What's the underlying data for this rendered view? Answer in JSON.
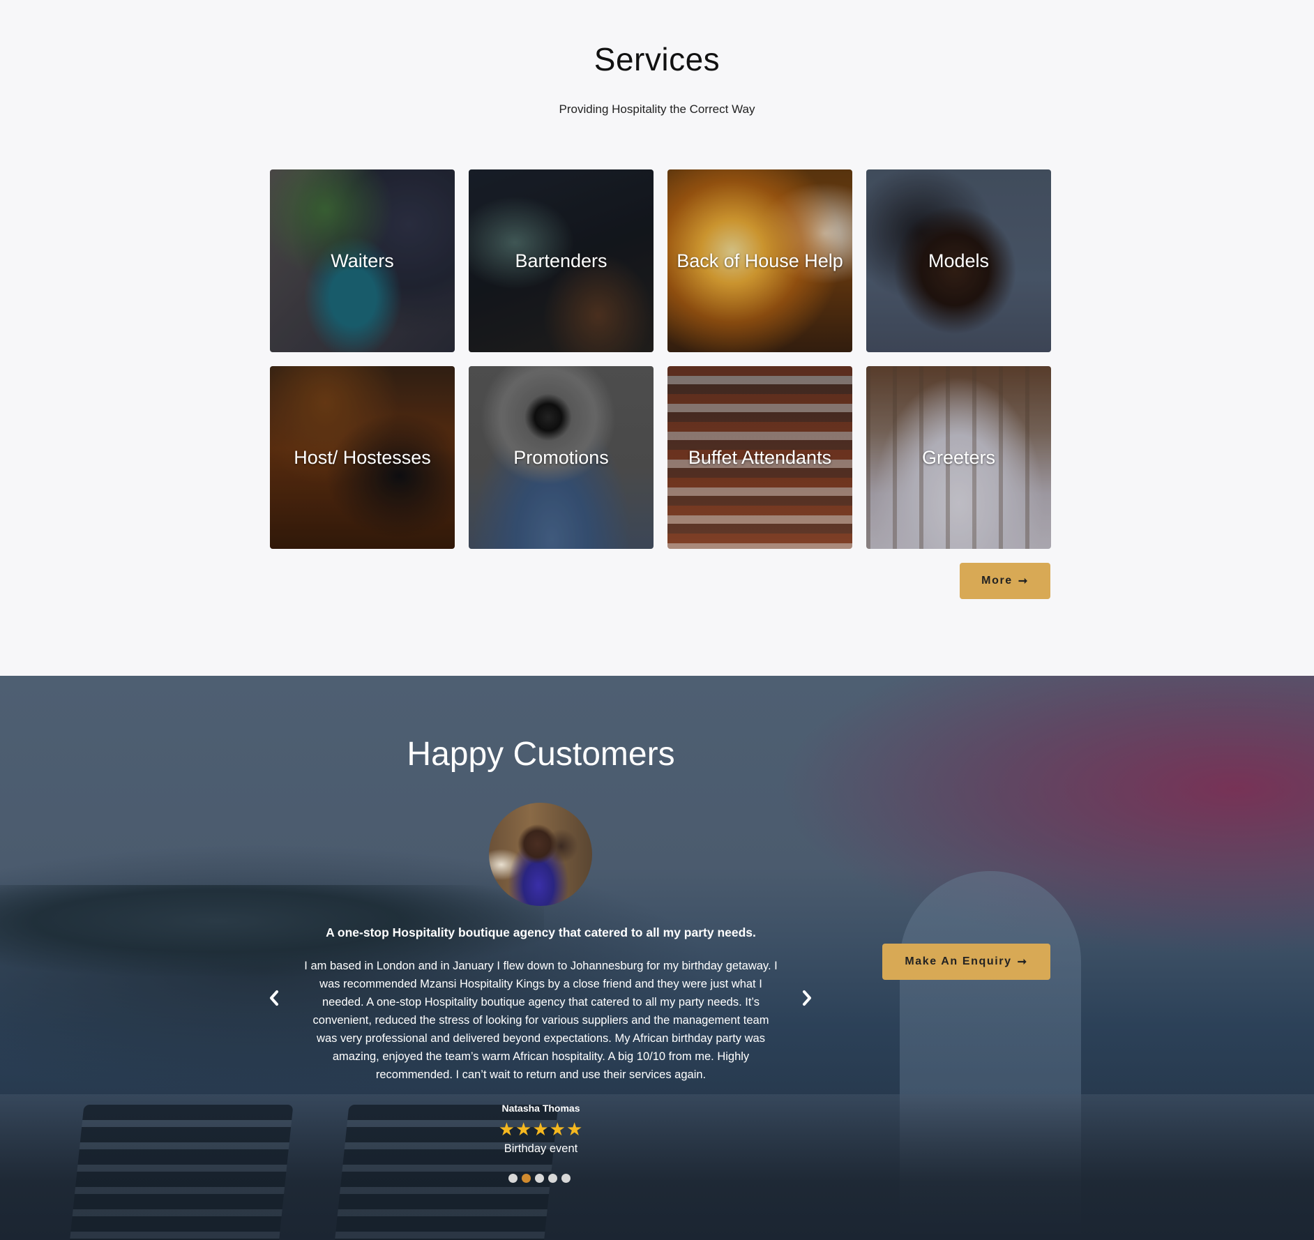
{
  "services": {
    "title": "Services",
    "subtitle": "Providing Hospitality the Correct Way",
    "cards": [
      {
        "label": "Waiters"
      },
      {
        "label": "Bartenders"
      },
      {
        "label": "Back of House Help"
      },
      {
        "label": "Models"
      },
      {
        "label": "Host/ Hostesses"
      },
      {
        "label": "Promotions"
      },
      {
        "label": "Buffet Attendants"
      },
      {
        "label": "Greeters"
      }
    ],
    "more_button": {
      "label": "More",
      "icon": "arrow-right-icon"
    }
  },
  "customers": {
    "title": "Happy Customers",
    "testimonial": {
      "headline": "A one-stop Hospitality boutique agency that catered to all my party needs.",
      "body": "I am based in London and in January I flew down to Johannesburg for my birthday getaway. I was recommended Mzansi Hospitality Kings by a close friend and they were just what I needed. A one-stop Hospitality boutique agency that catered to all my party needs. It’s convenient, reduced the stress of looking for various suppliers and the management team was very professional and delivered beyond expectations. My African birthday party was amazing, enjoyed the team’s warm African hospitality. A big 10/10 from me. Highly recommended. I can’t wait to return and use their services again.",
      "name": "Natasha Thomas",
      "rating": 5,
      "stars": "★★★★★",
      "event": "Birthday event"
    },
    "carousel": {
      "slide_count": 5,
      "active_index": 1,
      "prev_icon": "chevron-left-icon",
      "next_icon": "chevron-right-icon"
    },
    "enquiry_button": {
      "label": "Make An Enquiry",
      "icon": "arrow-right-icon"
    }
  },
  "colors": {
    "accent": "#d8a955",
    "page_background": "#f7f7f9",
    "star": "#f5b820",
    "active_dot": "#d18b2f"
  }
}
